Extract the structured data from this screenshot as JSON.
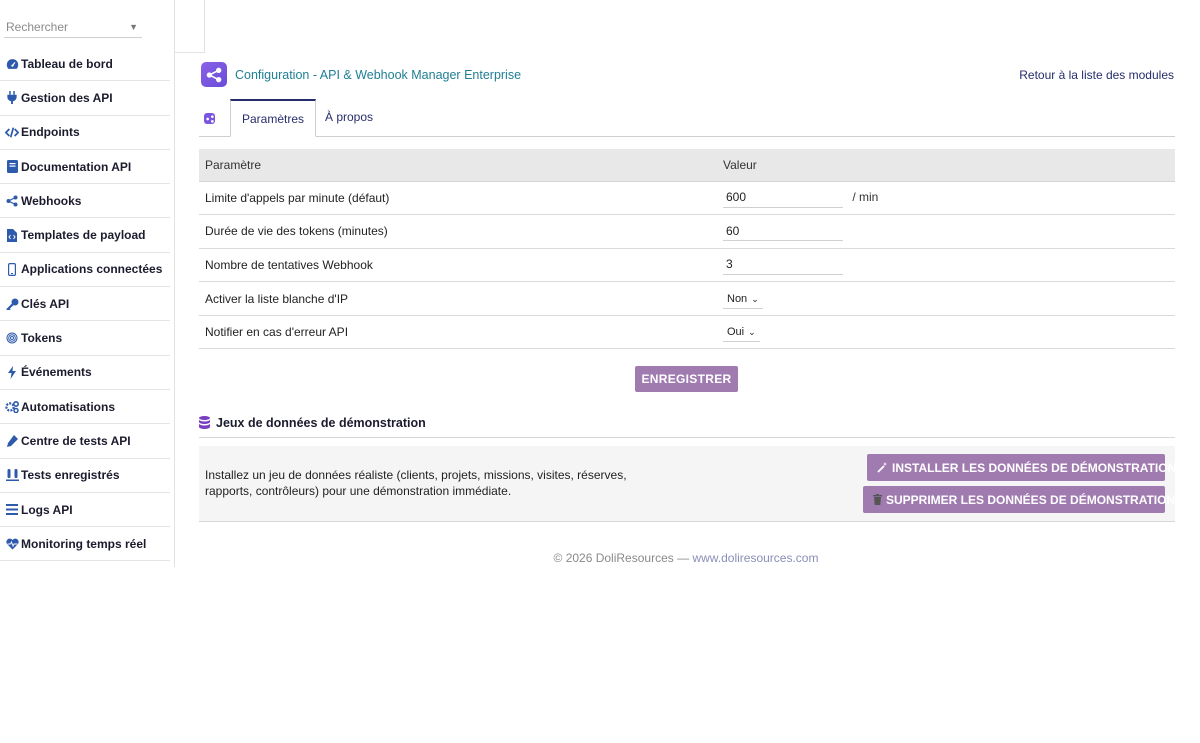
{
  "search": {
    "placeholder": "Rechercher"
  },
  "sidebar": {
    "items": [
      {
        "label": "Tableau de bord",
        "icon": "dashboard-icon"
      },
      {
        "label": "Gestion des API",
        "icon": "plug-icon"
      },
      {
        "label": "Endpoints",
        "icon": "code-icon"
      },
      {
        "label": "Documentation API",
        "icon": "book-icon"
      },
      {
        "label": "Webhooks",
        "icon": "share-icon"
      },
      {
        "label": "Templates de payload",
        "icon": "file-code-icon"
      },
      {
        "label": "Applications connectées",
        "icon": "mobile-icon"
      },
      {
        "label": "Clés API",
        "icon": "key-icon"
      },
      {
        "label": "Tokens",
        "icon": "fingerprint-icon"
      },
      {
        "label": "Événements",
        "icon": "bolt-icon"
      },
      {
        "label": "Automatisations",
        "icon": "cogs-icon"
      },
      {
        "label": "Centre de tests API",
        "icon": "flask-icon"
      },
      {
        "label": "Tests enregistrés",
        "icon": "vials-icon"
      },
      {
        "label": "Logs API",
        "icon": "list-icon"
      },
      {
        "label": "Monitoring temps réel",
        "icon": "heartbeat-icon"
      }
    ]
  },
  "header": {
    "title": "Configuration - API & Webhook Manager Enterprise",
    "back_link": "Retour à la liste des modules"
  },
  "tabs": [
    {
      "label": "Paramètres",
      "active": true
    },
    {
      "label": "À propos",
      "active": false
    }
  ],
  "table": {
    "headers": [
      "Paramètre",
      "Valeur"
    ],
    "rows": [
      {
        "label": "Limite d'appels par minute (défaut)",
        "value": "600",
        "unit": "/ min"
      },
      {
        "label": "Durée de vie des tokens (minutes)",
        "value": "60"
      },
      {
        "label": "Nombre de tentatives Webhook",
        "value": "3"
      },
      {
        "label": "Activer la liste blanche d'IP",
        "select": "Non"
      },
      {
        "label": "Notifier en cas d'erreur API",
        "select": "Oui"
      }
    ]
  },
  "save_label": "ENREGISTRER",
  "demo": {
    "title": "Jeux de données de démonstration",
    "description": "Installez un jeu de données réaliste (clients, projets, missions, visites, réserves, rapports, contrôleurs) pour une démonstration immédiate.",
    "install_label": "INSTALLER LES DONNÉES DE DÉMONSTRATION",
    "delete_label": "SUPPRIMER LES DONNÉES DE DÉMONSTRATION"
  },
  "footer": {
    "text": "© 2026 DoliResources —",
    "link": "www.doliresources.com"
  },
  "colors": {
    "accent": "#a07bb0",
    "title": "#1f7f94",
    "link": "#262d6b",
    "icon": "#2e5aac"
  }
}
